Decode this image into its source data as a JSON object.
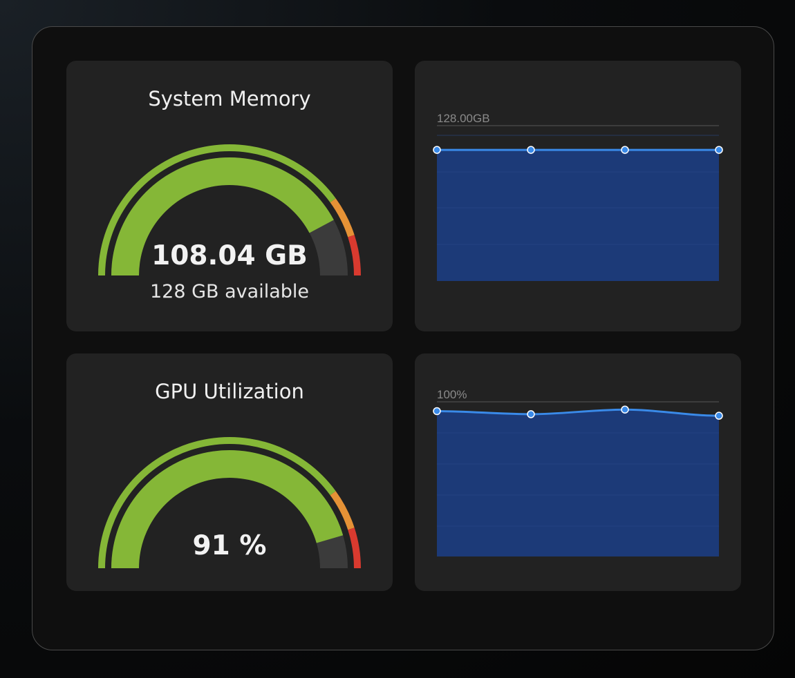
{
  "colors": {
    "gauge_fill": "#85b737",
    "gauge_track": "#3b3b3b",
    "warn": "#e59236",
    "danger": "#d93a2f",
    "chart_fill": "#1c3a78",
    "chart_line": "#3a8ae8"
  },
  "memory": {
    "title": "System Memory",
    "value": "108.04 GB",
    "subtitle": "128 GB available",
    "fraction": 0.844
  },
  "gpu": {
    "title": "GPU Utilization",
    "value": "91 %",
    "fraction": 0.91
  },
  "chart_data": [
    {
      "type": "area",
      "max_label": "128.00GB",
      "x": [
        0,
        1,
        2,
        3
      ],
      "values": [
        108.04,
        108.04,
        108.04,
        108.04
      ],
      "ylim": [
        0,
        128
      ]
    },
    {
      "type": "area",
      "max_label": "100%",
      "x": [
        0,
        1,
        2,
        3
      ],
      "values": [
        94,
        92,
        95,
        91
      ],
      "ylim": [
        0,
        100
      ]
    }
  ]
}
